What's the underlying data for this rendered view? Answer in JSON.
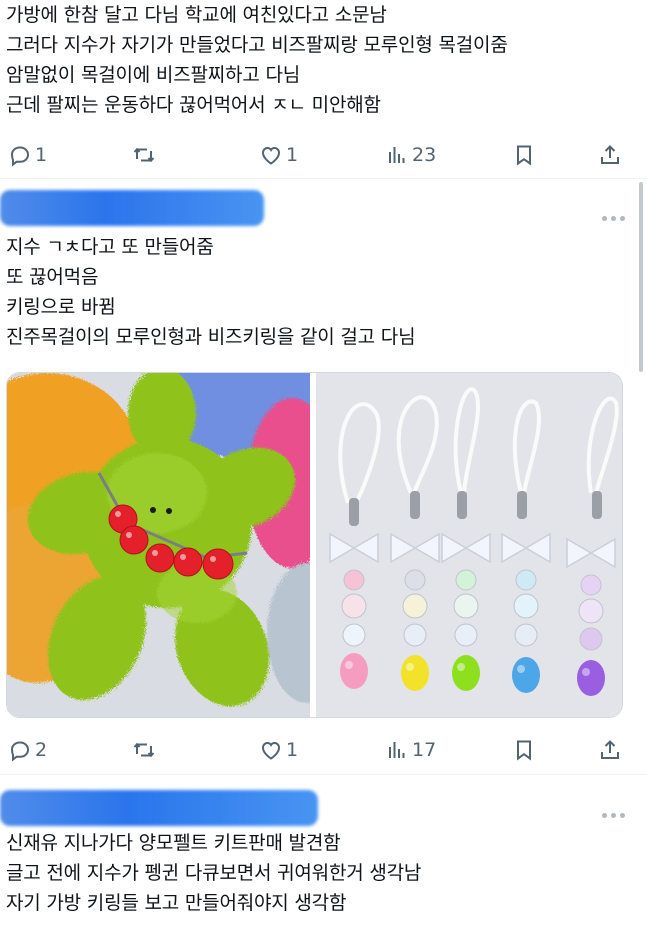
{
  "tweet1": {
    "lines": [
      "가방에 한참 달고 다님 학교에 여친있다고 소문남",
      "그러다 지수가 자기가 만들었다고 비즈팔찌랑 모루인형 목걸이줌",
      "암말없이 목걸이에 비즈팔찌하고 다님",
      "근데 팔찌는 운동하다 끊어먹어서 ㅈㄴ 미안해함"
    ],
    "actions": {
      "replies": "1",
      "likes": "1",
      "views": "23"
    }
  },
  "tweet2": {
    "lines": [
      "지수 ㄱㅊ다고 또 만들어줌",
      "또 끊어먹음",
      "키링으로 바뀜",
      "진주목걸이의 모루인형과 비즈키링을 같이 걸고 다님"
    ],
    "actions": {
      "replies": "2",
      "likes": "1",
      "views": "17"
    }
  },
  "tweet3": {
    "lines": [
      "신재유 지나가다 양모펠트 키트판매 발견함",
      "글고 전에 지수가 펭귄 다큐보면서 귀여워한거 생각남",
      "자기 가방 키링들 보고 만들어줘야지 생각함"
    ]
  },
  "colors": {
    "text": "#0f1419",
    "muted": "#536471",
    "divider": "#eff3f4"
  },
  "icons": [
    "reply-icon",
    "retweet-icon",
    "like-icon",
    "views-icon",
    "bookmark-icon",
    "share-icon",
    "more-icon"
  ]
}
